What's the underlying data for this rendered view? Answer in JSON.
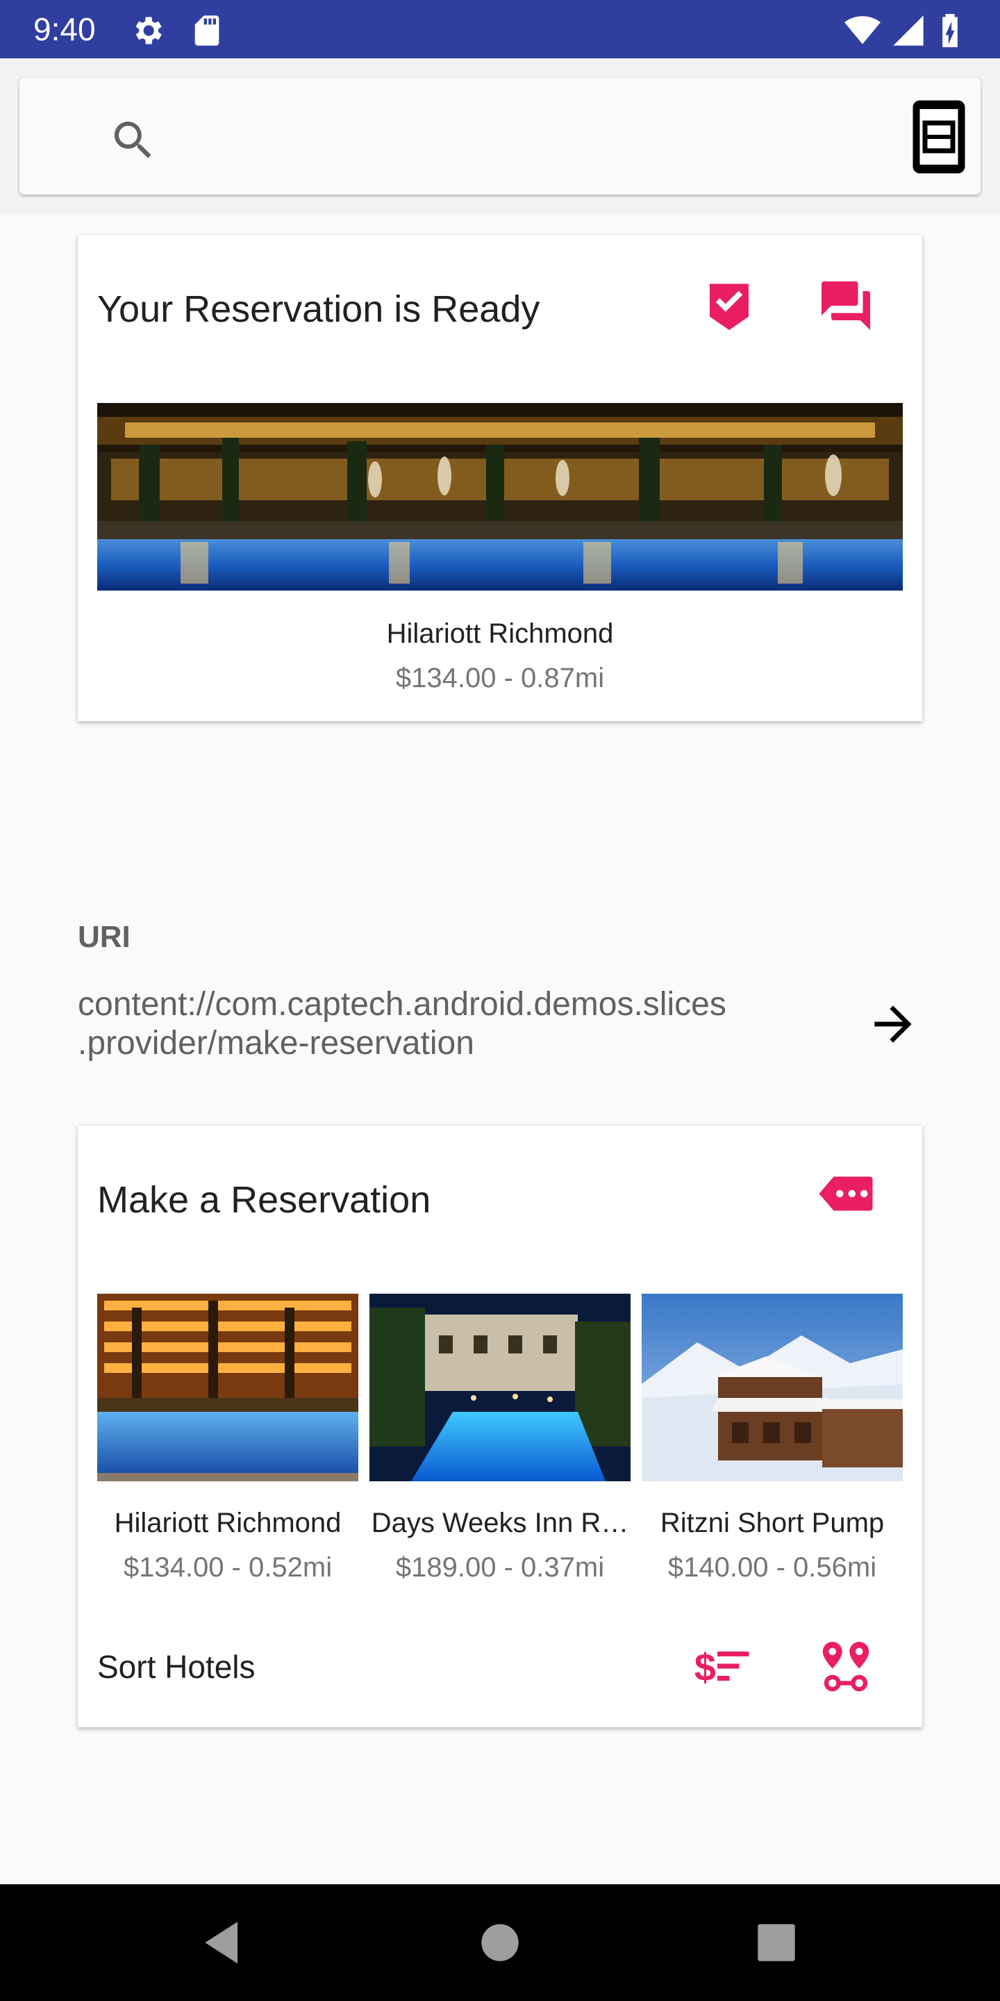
{
  "status_bar": {
    "time": "9:40",
    "background": "#303f9f",
    "icons": [
      "settings-icon",
      "sd-card-icon",
      "wifi-icon",
      "signal-icon",
      "battery-charging-icon"
    ]
  },
  "search_bar": {
    "icons": [
      "search-icon",
      "device-icon"
    ]
  },
  "accent_color": "#e91e63",
  "reservation_ready": {
    "title": "Your Reservation is Ready",
    "actions": [
      "verified-check-icon",
      "chat-icon"
    ],
    "hotel": {
      "name": "Hilariott Richmond",
      "detail": "$134.00 - 0.87mi"
    }
  },
  "uri_section": {
    "label": "URI",
    "uri": "content://com.captech.android.demos.slices .provider/make-reservation"
  },
  "make_reservation": {
    "title": "Make a Reservation",
    "action": "more-tag-icon",
    "hotels": [
      {
        "name": "Hilariott Richmond",
        "detail": "$134.00 - 0.52mi"
      },
      {
        "name": "Days Weeks Inn R…",
        "detail": "$189.00 - 0.37mi"
      },
      {
        "name": "Ritzni Short Pump",
        "detail": "$140.00 - 0.56mi"
      }
    ],
    "sort_label": "Sort Hotels",
    "sort_actions": [
      "sort-by-price-icon",
      "sort-by-distance-icon"
    ]
  },
  "nav_bar": {
    "buttons": [
      "back-icon",
      "home-icon",
      "recents-icon"
    ]
  }
}
